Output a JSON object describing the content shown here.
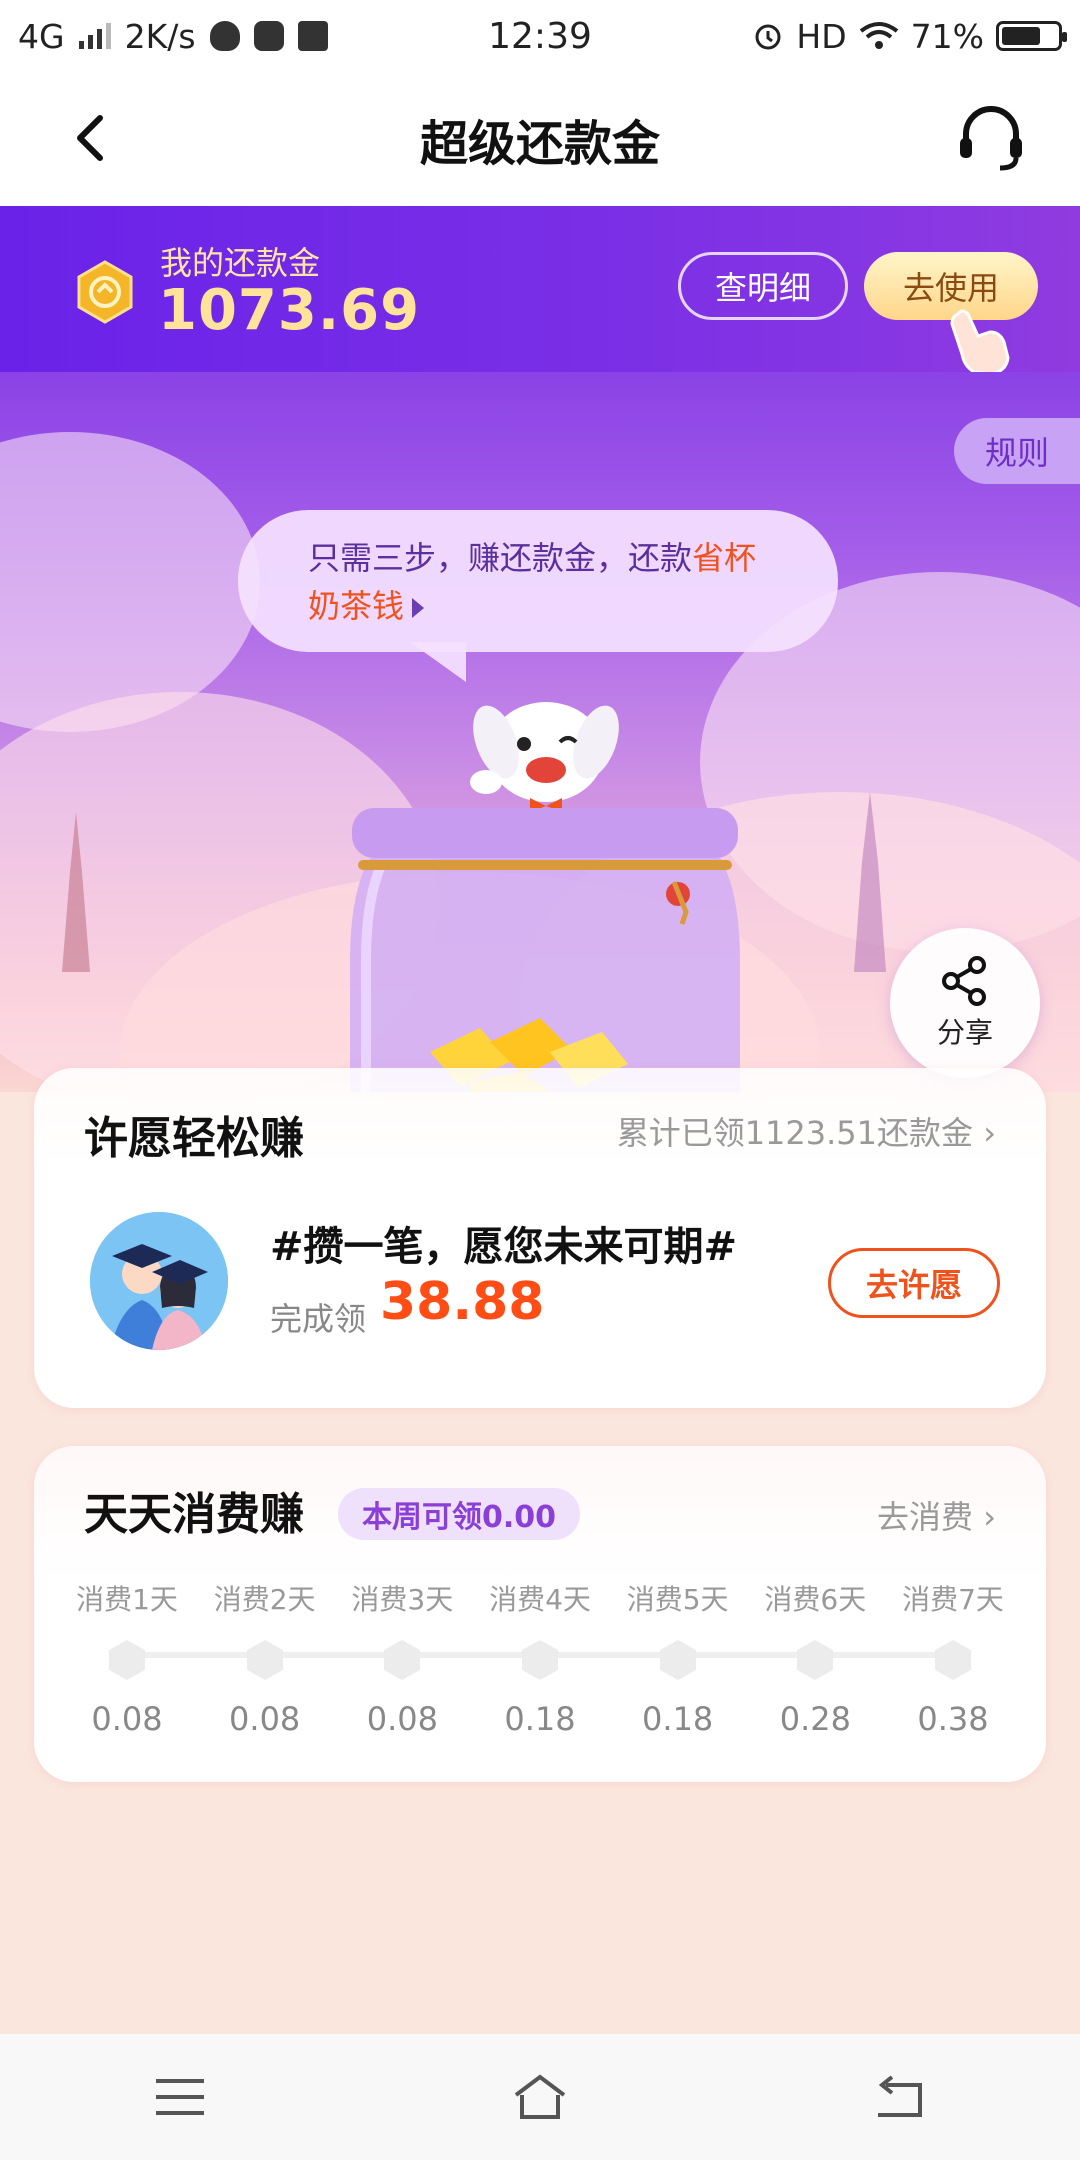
{
  "status_bar": {
    "network": "4G",
    "speed": "2K/s",
    "time": "12:39",
    "hd": "HD",
    "battery": "71%",
    "battery_level": 0.71
  },
  "navbar": {
    "title": "超级还款金"
  },
  "balance": {
    "label": "我的还款金",
    "amount": "1073.69",
    "detail_button": "查明细",
    "use_button": "去使用"
  },
  "hero": {
    "rules_tab": "规则",
    "bubble_prefix": "只需三步，赚还款金，还款",
    "bubble_highlight": "省杯奶茶钱",
    "share_label": "分享"
  },
  "wish_card": {
    "title": "许愿轻松赚",
    "cumulative_link": "累计已领1123.51还款金",
    "wish_text": "#攒一笔，愿您未来可期#",
    "reward_label": "完成领",
    "reward_amount": "38.88",
    "wish_button": "去许愿"
  },
  "daily_card": {
    "title": "天天消费赚",
    "week_badge": "本周可领0.00",
    "spend_link": "去消费",
    "days": [
      {
        "label": "消费1天",
        "value": "0.08"
      },
      {
        "label": "消费2天",
        "value": "0.08"
      },
      {
        "label": "消费3天",
        "value": "0.08"
      },
      {
        "label": "消费4天",
        "value": "0.18"
      },
      {
        "label": "消费5天",
        "value": "0.18"
      },
      {
        "label": "消费6天",
        "value": "0.28"
      },
      {
        "label": "消费7天",
        "value": "0.38"
      }
    ]
  },
  "colors": {
    "brand_purple": "#6a22e8",
    "accent_orange": "#f0521c",
    "gold": "#ffe39a"
  }
}
